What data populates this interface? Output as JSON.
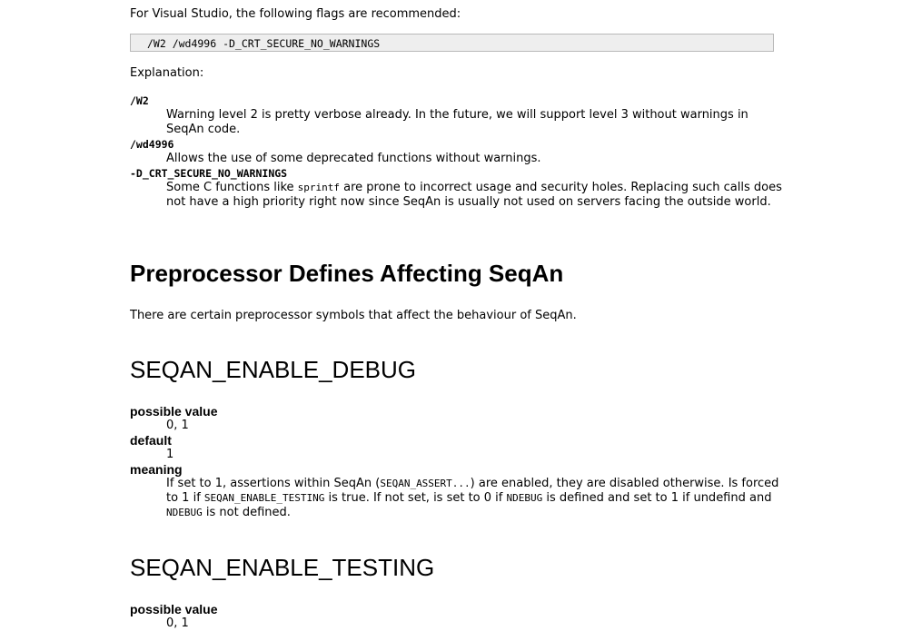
{
  "intro": {
    "text": "For Visual Studio, the following flags are recommended:",
    "code": "/W2 /wd4996 -D_CRT_SECURE_NO_WARNINGS",
    "explanation_label": "Explanation:"
  },
  "flags": [
    {
      "term": "/W2",
      "desc": "Warning level 2 is pretty verbose already. In the future, we will support level 3 without warnings in SeqAn code."
    },
    {
      "term": "/wd4996",
      "desc": "Allows the use of some deprecated functions without warnings."
    },
    {
      "term": "-D_CRT_SECURE_NO_WARNINGS",
      "desc_before": "Some C functions like ",
      "desc_code": "sprintf",
      "desc_after": " are prone to incorrect usage and security holes. Replacing such calls does not have a high priority right now since SeqAn is usually not used on servers facing the outside world."
    }
  ],
  "section": {
    "title": "Preprocessor Defines Affecting SeqAn",
    "intro": "There are certain preprocessor symbols that affect the behaviour of SeqAn."
  },
  "debug": {
    "title": "SEQAN_ENABLE_DEBUG",
    "possible_label": "possible value",
    "possible_value": "0, 1",
    "default_label": "default",
    "default_value": "1",
    "meaning_label": "meaning",
    "meaning_t1": "If set to 1, assertions within SeqAn (",
    "meaning_c1": "SEQAN_ASSERT...",
    "meaning_t2": ") are enabled, they are disabled otherwise. Is forced to 1 if ",
    "meaning_c2": "SEQAN_ENABLE_TESTING",
    "meaning_t3": " is true. If not set, is set to 0 if ",
    "meaning_c3": "NDEBUG",
    "meaning_t4": " is defined and set to 1 if undefind and ",
    "meaning_c4": "NDEBUG",
    "meaning_t5": " is not defined."
  },
  "testing": {
    "title": "SEQAN_ENABLE_TESTING",
    "possible_label": "possible value",
    "possible_value": "0, 1"
  }
}
